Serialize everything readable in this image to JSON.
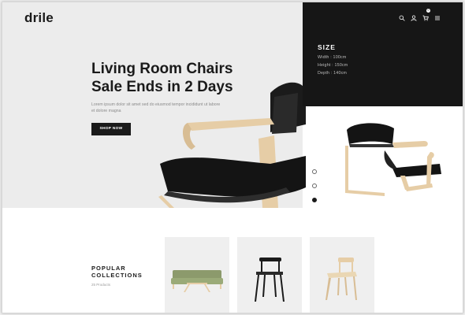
{
  "header": {
    "logo": "drile",
    "icons": [
      "search-icon",
      "user-icon",
      "cart-icon",
      "menu-icon"
    ],
    "cart_count": "0"
  },
  "hero": {
    "headline_line1": "Living Room Chairs",
    "headline_line2": "Sale Ends in 2 Days",
    "description": "Lorem ipsum dolor sit amet sed do eiusmod tempor incididunt ut labore et dolore magna",
    "button_label": "SHOP NOW"
  },
  "specs": {
    "title": "SIZE",
    "items": [
      "Width : 100cm",
      "Height : 150cm",
      "Depth : 140cm"
    ]
  },
  "slider": {
    "dot_count": 3,
    "active_dot": 3
  },
  "collections": {
    "title_line1": "POPULAR",
    "title_line2": "COLLECTIONS",
    "count": "25 Products",
    "cards": [
      "sofa-image",
      "dining-chair-image",
      "wooden-chair-image"
    ]
  },
  "colors": {
    "dark": "#161616",
    "hero_bg": "#ececec",
    "card_bg": "#efefef",
    "sofa_green": "#8c9a6c",
    "wood": "#e6cda6"
  }
}
